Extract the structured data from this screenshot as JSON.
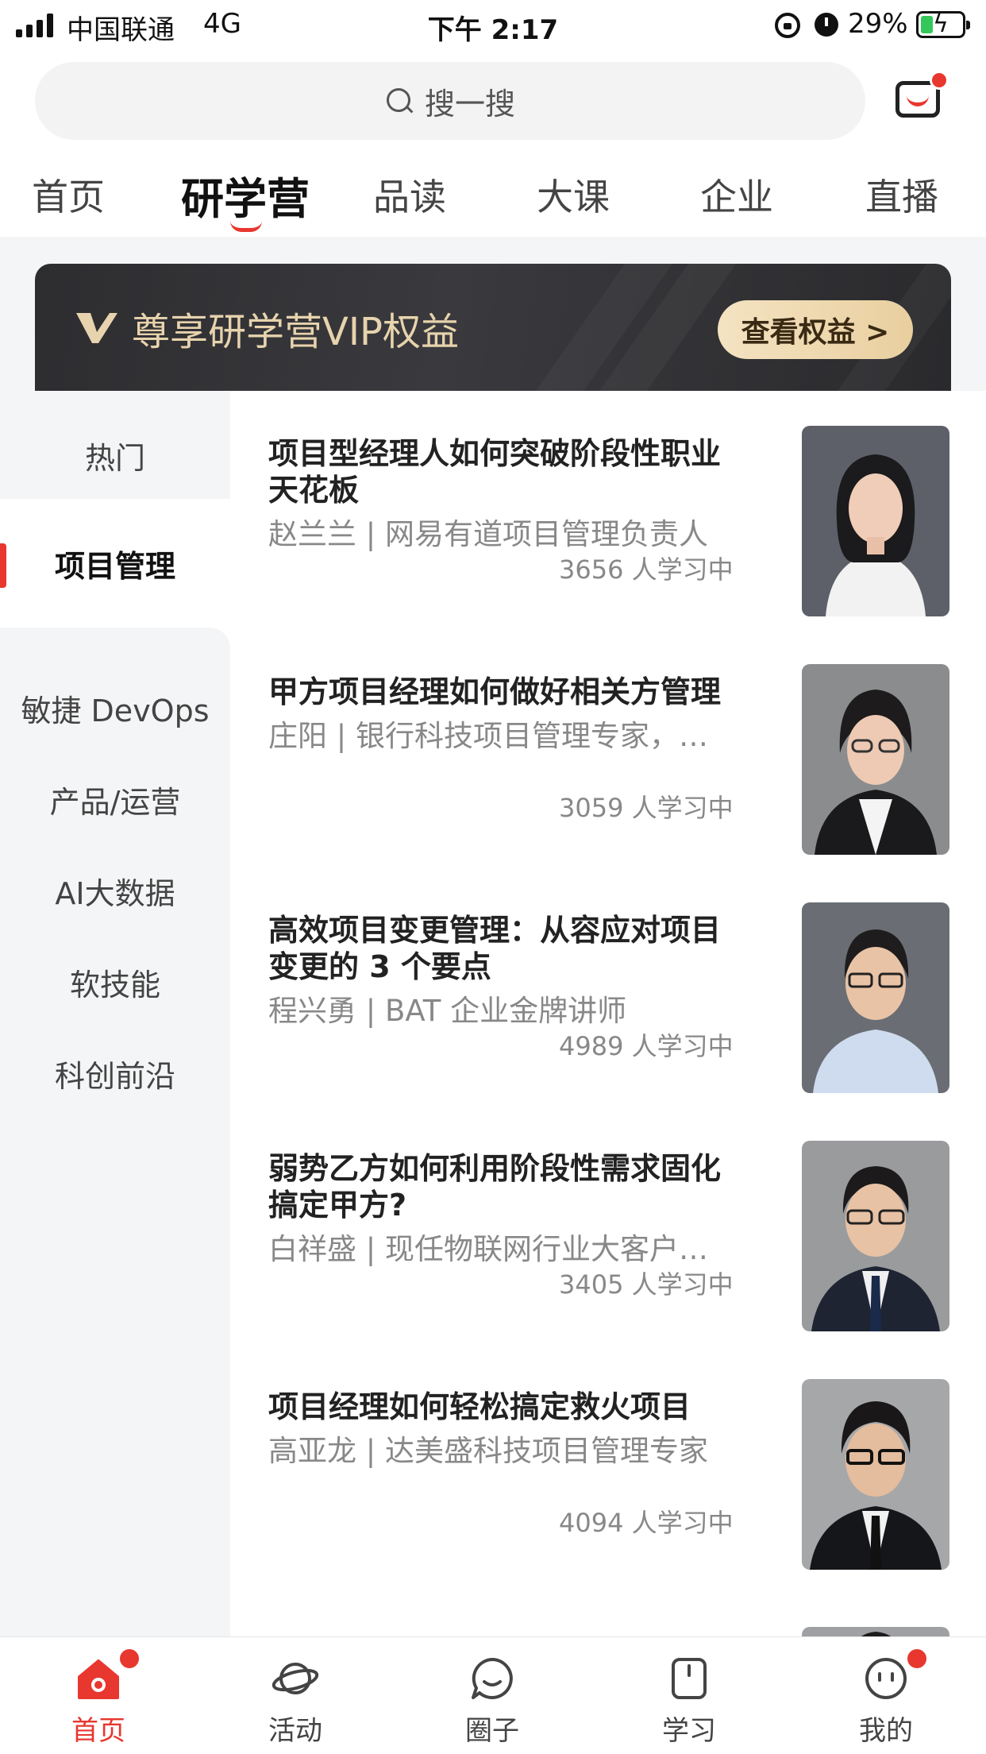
{
  "status_bar": {
    "carrier": "中国联通",
    "network": "4G",
    "time": "下午 2:17",
    "battery_percent": "29%",
    "battery_level": 0.29
  },
  "search": {
    "placeholder": "搜一搜"
  },
  "tabs": [
    {
      "label": "首页",
      "active": false
    },
    {
      "label": "研学营",
      "active": true
    },
    {
      "label": "品读",
      "active": false
    },
    {
      "label": "大课",
      "active": false
    },
    {
      "label": "企业",
      "active": false
    },
    {
      "label": "直播",
      "active": false
    }
  ],
  "vip_banner": {
    "text": "尊享研学营VIP权益",
    "button_label": "查看权益 >",
    "text_color": "#e7d3ad"
  },
  "categories": [
    {
      "label": "热门",
      "active": false
    },
    {
      "label": "项目管理",
      "active": true
    },
    {
      "label": "敏捷 DevOps",
      "active": false
    },
    {
      "label": "产品/运营",
      "active": false
    },
    {
      "label": "AI大数据",
      "active": false
    },
    {
      "label": "软技能",
      "active": false
    },
    {
      "label": "科创前沿",
      "active": false
    }
  ],
  "courses": [
    {
      "title_lines": [
        "项目型经理人如何突破阶段性职业",
        "天花板"
      ],
      "meta": "赵兰兰 | 网易有道项目管理负责人",
      "count": "3656 人学习中",
      "avatar": "female-instructor-1"
    },
    {
      "title_lines": [
        "甲方项目经理如何做好相关方管理",
        ""
      ],
      "meta": "庄阳 | 银行科技项目管理专家，…",
      "count": "3059 人学习中",
      "avatar": "female-instructor-2"
    },
    {
      "title_lines": [
        "高效项目变更管理：从容应对项目",
        "变更的 3 个要点"
      ],
      "meta": "程兴勇 | BAT 企业金牌讲师",
      "count": "4989 人学习中",
      "avatar": "male-instructor-1"
    },
    {
      "title_lines": [
        "弱势乙方如何利用阶段性需求固化",
        "搞定甲方?"
      ],
      "meta": "白祥盛 | 现任物联网行业大客户…",
      "count": "3405 人学习中",
      "avatar": "male-instructor-2"
    },
    {
      "title_lines": [
        "项目经理如何轻松搞定救火项目",
        ""
      ],
      "meta": "高亚龙 | 达美盛科技项目管理专家",
      "count": "4094 人学习中",
      "avatar": "male-instructor-3"
    }
  ],
  "bottom_nav": [
    {
      "label": "首页",
      "icon": "home-icon",
      "active": true,
      "badge": true
    },
    {
      "label": "活动",
      "icon": "planet-icon",
      "active": false,
      "badge": false
    },
    {
      "label": "圈子",
      "icon": "chat-bubble-icon",
      "active": false,
      "badge": false
    },
    {
      "label": "学习",
      "icon": "book-icon",
      "active": false,
      "badge": false
    },
    {
      "label": "我的",
      "icon": "profile-face-icon",
      "active": false,
      "badge": true
    }
  ],
  "colors": {
    "accent": "#e8372f",
    "battery_green": "#34c759",
    "vip_gold": "#e9cf9f"
  }
}
